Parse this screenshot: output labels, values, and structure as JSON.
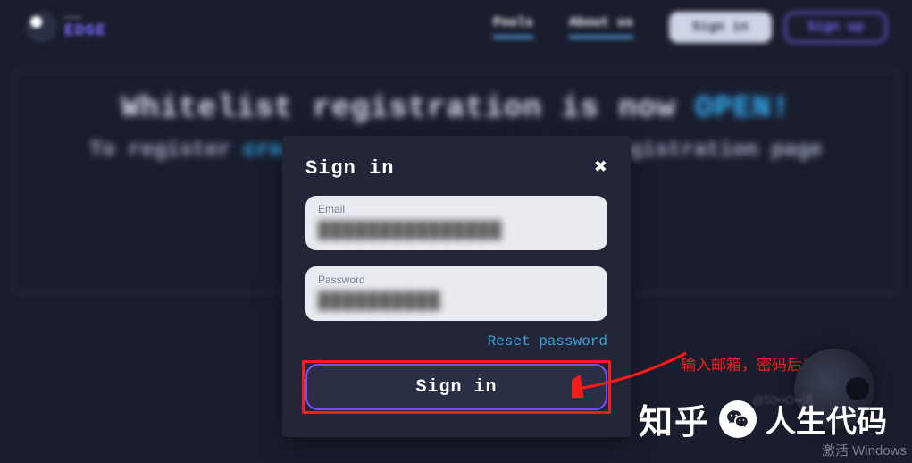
{
  "header": {
    "brand_small": "———",
    "brand": "EDGE",
    "nav": {
      "pools": "Pools",
      "about": "About us"
    },
    "signin": "Sign in",
    "signup": "Sign up"
  },
  "banner": {
    "line1_a": "Whitelist registration is now ",
    "line1_b": "OPEN!",
    "line2_a": "To register ",
    "line2_b": "create an account",
    "line2_c": " and visit registration page"
  },
  "modal": {
    "title": "Sign in",
    "email_label": "Email",
    "email_value": "███████████████",
    "password_label": "Password",
    "password_value": "██████████",
    "reset": "Reset password",
    "submit": "Sign in"
  },
  "annotation": {
    "text": "输入邮箱，密码后登陆"
  },
  "footer": {
    "zhihu": "知乎",
    "tail": "人生代码",
    "activate": "激活 Windows",
    "cred": "@50••O••活"
  }
}
